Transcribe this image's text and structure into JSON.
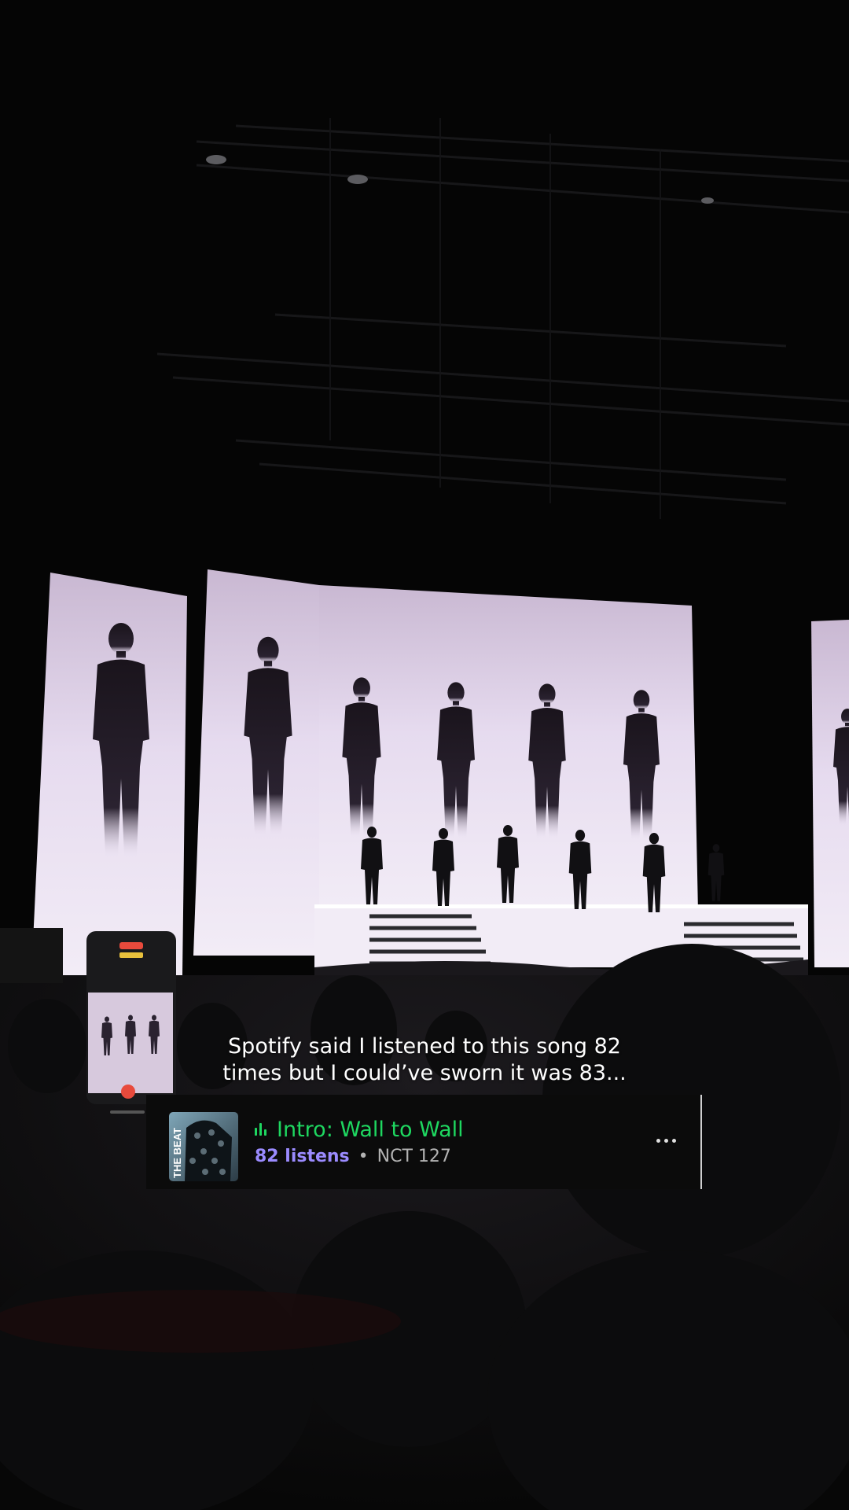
{
  "caption": {
    "line1": "Spotify said I listened to this song 82",
    "line2": "times but I could’ve sworn it was 83..."
  },
  "track": {
    "title": "Intro: Wall to Wall",
    "listens": "82 listens",
    "separator": "•",
    "artist": "NCT 127",
    "cover_text": "THE BEAT",
    "now_playing_icon": "equalizer-icon",
    "more_icon": "more-horizontal-icon"
  },
  "colors": {
    "background": "#050505",
    "spotify_green": "#1ed760",
    "listens_purple": "#9b8bff",
    "stage_screen": "#e8dcf0",
    "card_bg": "#0b0b0b"
  }
}
